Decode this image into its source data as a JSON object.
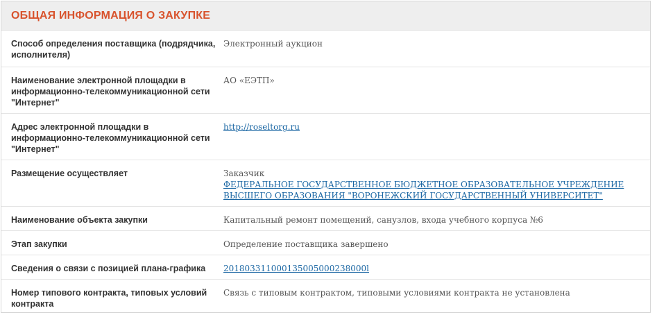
{
  "section": {
    "title": "ОБЩАЯ ИНФОРМАЦИЯ О ЗАКУПКЕ"
  },
  "rows": [
    {
      "label": "Способ определения поставщика (подрядчика, исполнителя)",
      "value": "Электронный аукцион"
    },
    {
      "label": "Наименование электронной площадки в информационно-телекоммуникационной сети \"Интернет\"",
      "value": "АО «ЕЭТП»"
    },
    {
      "label": "Адрес электронной площадки в информационно-телекоммуникационной сети \"Интернет\"",
      "link": "http://roseltorg.ru"
    },
    {
      "label": "Размещение осуществляет",
      "value": "Заказчик",
      "link": "ФЕДЕРАЛЬНОЕ ГОСУДАРСТВЕННОЕ БЮДЖЕТНОЕ ОБРАЗОВАТЕЛЬНОЕ УЧРЕЖДЕНИЕ ВЫСШЕГО ОБРАЗОВАНИЯ \"ВОРОНЕЖСКИЙ ГОСУДАРСТВЕННЫЙ УНИВЕРСИТЕТ\""
    },
    {
      "label": "Наименование объекта закупки",
      "value": "Капитальный ремонт помещений, санузлов, входа учебного корпуса №6"
    },
    {
      "label": "Этап закупки",
      "value": "Определение поставщика завершено"
    },
    {
      "label": "Сведения о связи с позицией плана-графика",
      "link": "201803311000135005000238000l"
    },
    {
      "label": "Номер типового контракта, типовых условий контракта",
      "value": "Связь с типовым контрактом, типовыми условиями контракта не установлена"
    }
  ],
  "colors": {
    "title": "#d8532d",
    "link": "#1a66a3",
    "header_bg": "#eeeeee"
  }
}
